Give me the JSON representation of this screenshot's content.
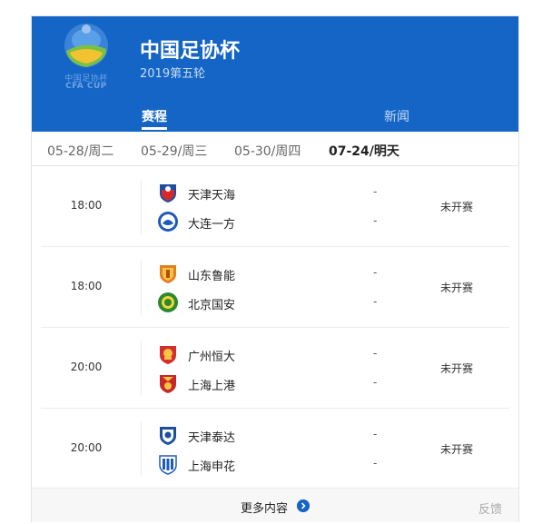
{
  "header": {
    "title": "中国足协杯",
    "subtitle": "2019第五轮",
    "logo_text_cn": "中国足协杯",
    "logo_text_en": "CFA CUP",
    "tabs": [
      {
        "label": "赛程",
        "active": true
      },
      {
        "label": "新闻",
        "active": false
      }
    ]
  },
  "dates": [
    {
      "label": "05-28/周二",
      "active": false
    },
    {
      "label": "05-29/周三",
      "active": false
    },
    {
      "label": "05-30/周四",
      "active": false
    },
    {
      "label": "07-24/明天",
      "active": true
    }
  ],
  "matches": [
    {
      "time": "18:00",
      "home": {
        "name": "天津天海",
        "badge": "tianjin-tianhai-badge"
      },
      "away": {
        "name": "大连一方",
        "badge": "dalian-yifang-badge"
      },
      "home_score": "-",
      "away_score": "-",
      "status": "未开赛"
    },
    {
      "time": "18:00",
      "home": {
        "name": "山东鲁能",
        "badge": "shandong-luneng-badge"
      },
      "away": {
        "name": "北京国安",
        "badge": "beijing-guoan-badge"
      },
      "home_score": "-",
      "away_score": "-",
      "status": "未开赛"
    },
    {
      "time": "20:00",
      "home": {
        "name": "广州恒大",
        "badge": "guangzhou-evergrande-badge"
      },
      "away": {
        "name": "上海上港",
        "badge": "shanghai-sipg-badge"
      },
      "home_score": "-",
      "away_score": "-",
      "status": "未开赛"
    },
    {
      "time": "20:00",
      "home": {
        "name": "天津泰达",
        "badge": "tianjin-teda-badge"
      },
      "away": {
        "name": "上海申花",
        "badge": "shanghai-shenhua-badge"
      },
      "home_score": "-",
      "away_score": "-",
      "status": "未开赛"
    }
  ],
  "footer": {
    "more_label": "更多内容",
    "more_icon": "chevron-right-icon",
    "feedback_label": "反馈"
  },
  "colors": {
    "brand_blue": "#1465c6"
  }
}
